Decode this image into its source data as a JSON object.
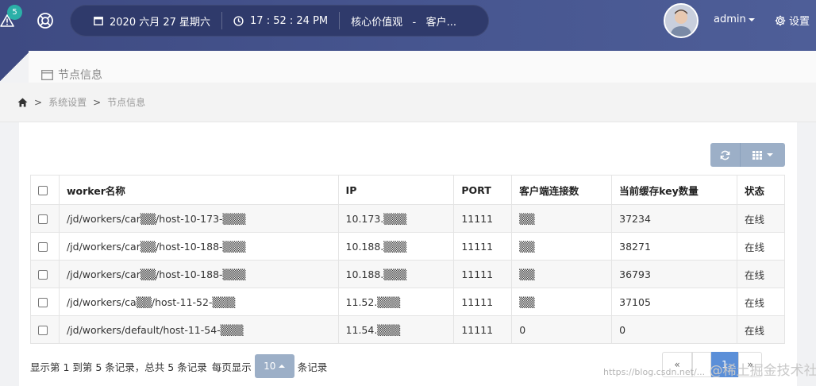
{
  "topbar": {
    "alert_count": "5",
    "date": "2020 六月 27 星期六",
    "time": "17 : 52 : 24 PM",
    "marquee": "核心价值观   -   客户...",
    "user": "admin",
    "settings_label": "设置"
  },
  "page": {
    "title": "节点信息"
  },
  "breadcrumb": {
    "items": [
      "系统设置",
      "节点信息"
    ]
  },
  "table": {
    "headers": [
      "worker名称",
      "IP",
      "PORT",
      "客户端连接数",
      "当前缓存key数量",
      "状态"
    ],
    "rows": [
      {
        "name": "/jd/workers/car▒▒/host-10-173-▒▒▒",
        "ip": "10.173.▒▒▒",
        "port": "11111",
        "clients": "▒▒",
        "keys": "37234",
        "status": "在线"
      },
      {
        "name": "/jd/workers/car▒▒/host-10-188-▒▒▒",
        "ip": "10.188.▒▒▒",
        "port": "11111",
        "clients": "▒▒",
        "keys": "38271",
        "status": "在线"
      },
      {
        "name": "/jd/workers/car▒▒/host-10-188-▒▒▒",
        "ip": "10.188.▒▒▒",
        "port": "11111",
        "clients": "▒▒",
        "keys": "36793",
        "status": "在线"
      },
      {
        "name": "/jd/workers/ca▒▒/host-11-52-▒▒▒",
        "ip": "11.52.▒▒▒",
        "port": "11111",
        "clients": "▒▒",
        "keys": "37105",
        "status": "在线"
      },
      {
        "name": "/jd/workers/default/host-11-54-▒▒▒",
        "ip": "11.54.▒▒▒",
        "port": "11111",
        "clients": "0",
        "keys": "0",
        "status": "在线"
      }
    ]
  },
  "footer": {
    "summary": "显示第 1 到第 5 条记录，总共 5 条记录",
    "per_page_prefix": "每页显示",
    "page_size": "10",
    "per_page_suffix": "条记录"
  },
  "pagination": {
    "prev": "«",
    "current": "1",
    "next": "»"
  },
  "watermark": {
    "text": "https://blog.csdn.net/...",
    "brand": "@稀土掘金技术社区"
  },
  "colors": {
    "topbar": "#46558f",
    "pill": "#2f3a6b",
    "accent_button": "#9cafc7",
    "badge": "#2bb0a8",
    "active_page": "#5b8fd8"
  }
}
